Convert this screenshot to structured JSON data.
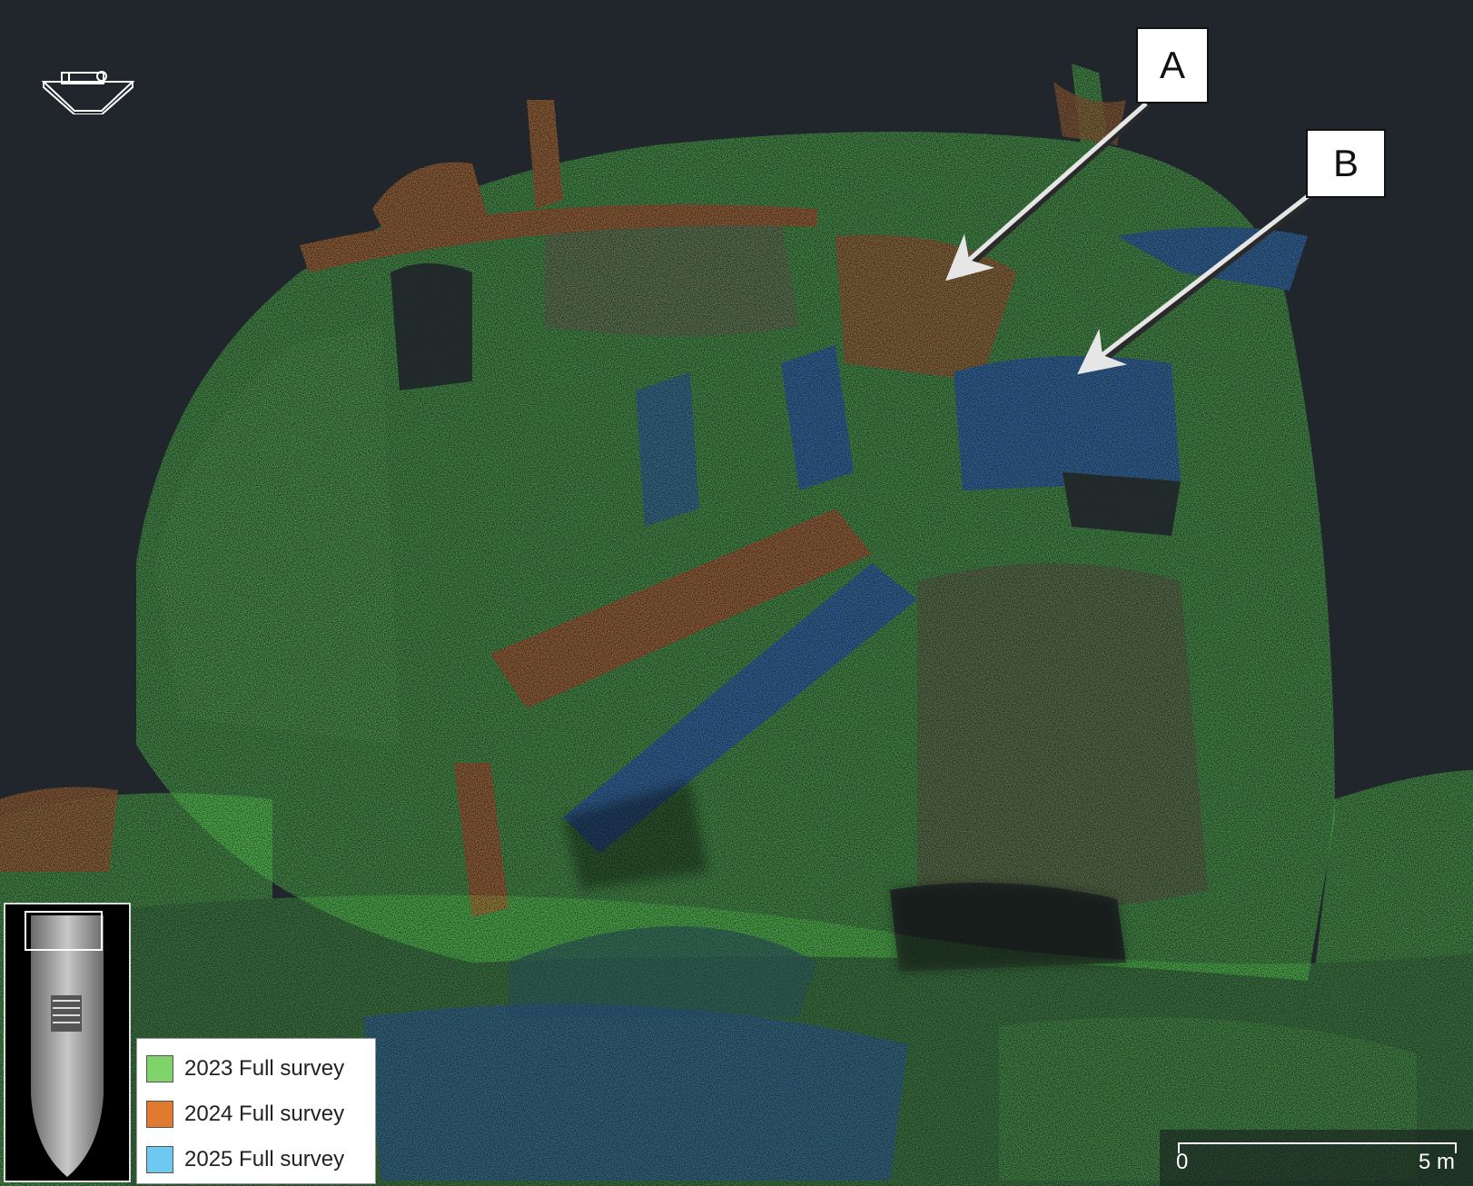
{
  "callouts": {
    "a": "A",
    "b": "B"
  },
  "legend": {
    "items": [
      {
        "label": "2023 Full survey",
        "color": "#7fd36a"
      },
      {
        "label": "2024 Full survey",
        "color": "#e07a2e"
      },
      {
        "label": "2025 Full survey",
        "color": "#6ec8f0"
      }
    ]
  },
  "scalebar": {
    "min_label": "0",
    "max_label": "5 m"
  },
  "colors": {
    "background": "#20262b",
    "green": "#4fbf45",
    "orange": "#d9762a",
    "blue": "#2f7fd6",
    "arrow": "#e6e6e6"
  },
  "icons": {
    "orientation": "orientation-cube-icon",
    "minimap": "ship-overview-minimap"
  }
}
